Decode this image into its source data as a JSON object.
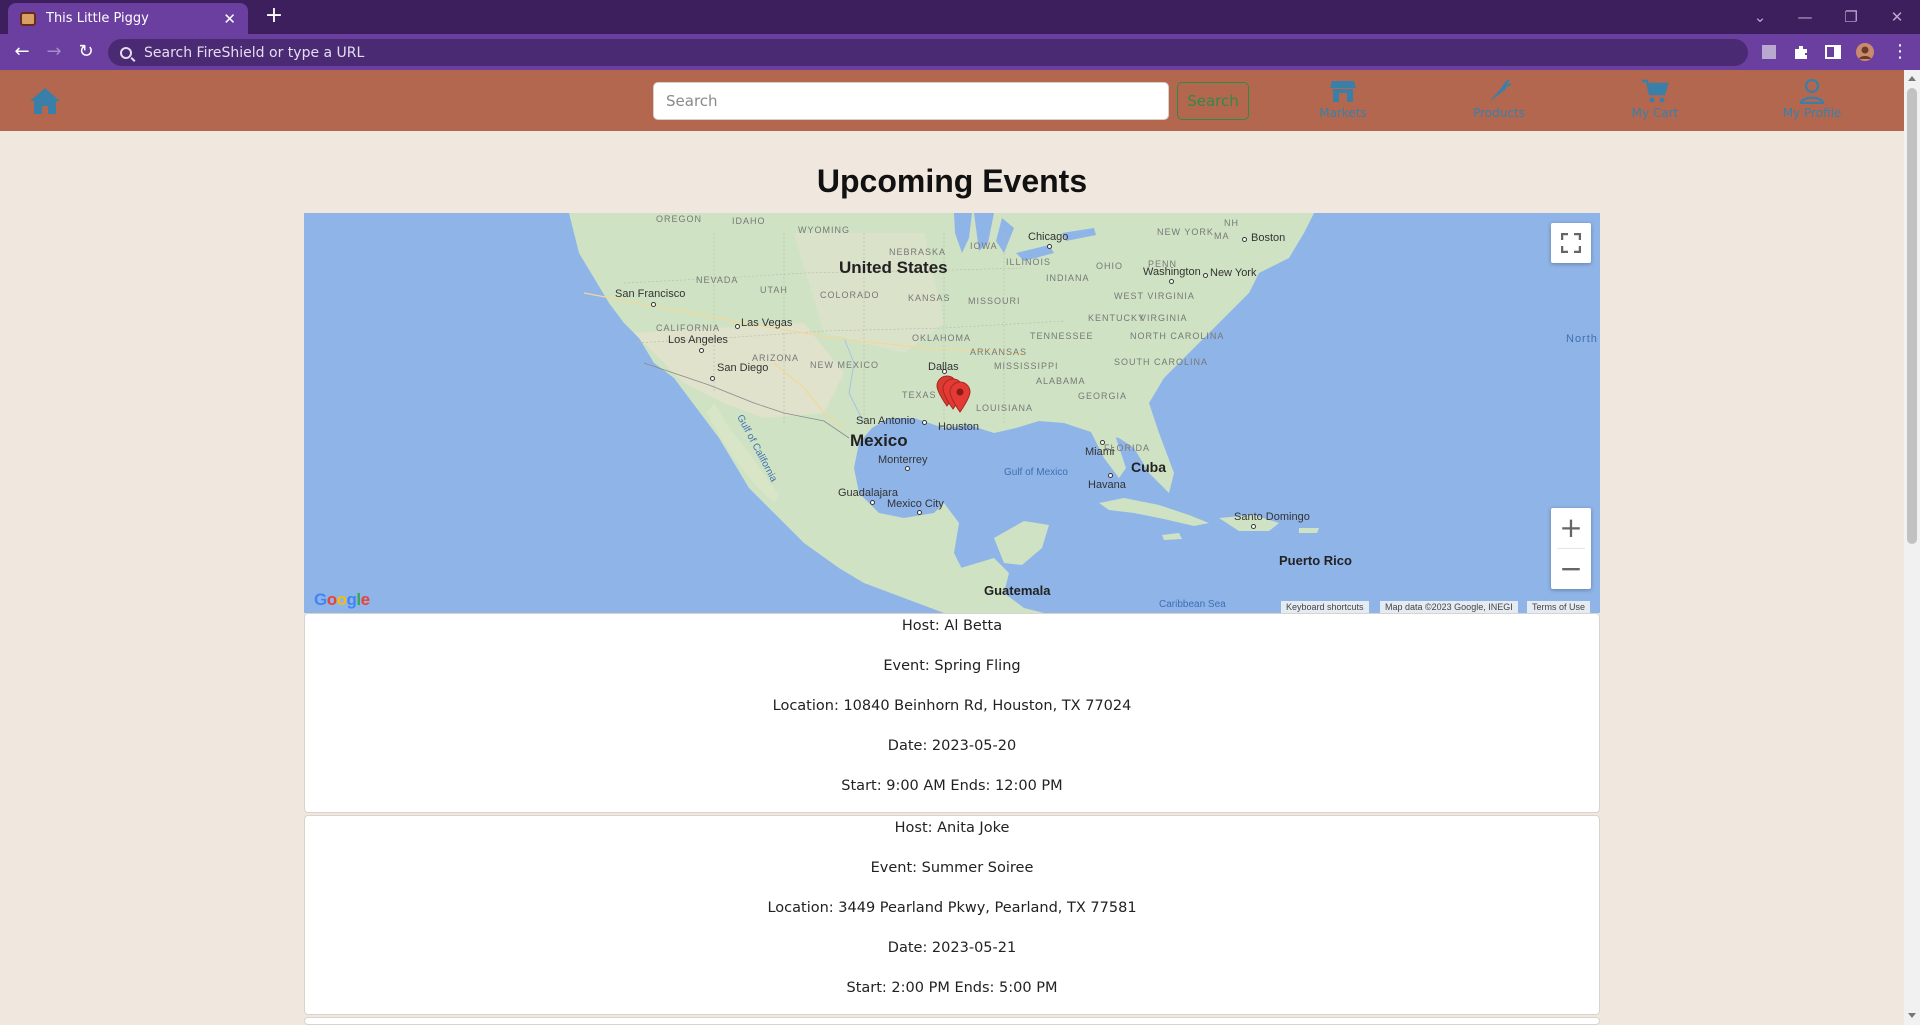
{
  "browser": {
    "tab_title": "This Little Piggy",
    "omnibox_placeholder": "Search FireShield or type a URL"
  },
  "header": {
    "search_placeholder": "Search",
    "search_button": "Search",
    "nav": [
      {
        "label": "Markets",
        "icon": "market-icon"
      },
      {
        "label": "Products",
        "icon": "carrot-icon"
      },
      {
        "label": "My Cart",
        "icon": "cart-icon"
      },
      {
        "label": "My Profile",
        "icon": "profile-icon"
      }
    ]
  },
  "page": {
    "title": "Upcoming Events"
  },
  "map": {
    "countries": [
      "United States",
      "Mexico",
      "Cuba",
      "Guatemala",
      "Puerto Rico"
    ],
    "states": [
      "OREGON",
      "IDAHO",
      "WYOMING",
      "NEBRASKA",
      "IOWA",
      "ILLINOIS",
      "NEVADA",
      "UTAH",
      "COLORADO",
      "KANSAS",
      "MISSOURI",
      "INDIANA",
      "OHIO",
      "PENN",
      "NEW YORK",
      "NH",
      "MA",
      "CALIFORNIA",
      "ARIZONA",
      "NEW MEXICO",
      "OKLAHOMA",
      "ARKANSAS",
      "TENNESSEE",
      "KENTUCKY",
      "WEST VIRGINIA",
      "VIRGINIA",
      "NORTH CAROLINA",
      "SOUTH CAROLINA",
      "MISSISSIPPI",
      "ALABAMA",
      "GEORGIA",
      "TEXAS",
      "LOUISIANA",
      "FLORIDA"
    ],
    "cities": [
      "San Francisco",
      "Las Vegas",
      "Los Angeles",
      "San Diego",
      "Dallas",
      "San Antonio",
      "Houston",
      "Chicago",
      "Boston",
      "New York",
      "Washington",
      "Monterrey",
      "Guadalajara",
      "Mexico City",
      "Miami",
      "Havana",
      "Santo Domingo"
    ],
    "waters": [
      "Gulf of Mexico",
      "Gulf of California",
      "Caribbean Sea",
      "North Atlantic Ocean"
    ],
    "attribution": {
      "keyboard": "Keyboard shortcuts",
      "data": "Map data ©2023 Google, INEGI",
      "terms": "Terms of Use"
    },
    "logo": "Google"
  },
  "events": [
    {
      "host": "Host: Al Betta",
      "event": "Event: Spring Fling",
      "location": "Location: 10840 Beinhorn Rd, Houston, TX 77024",
      "date": "Date: 2023-05-20",
      "time": "Start: 9:00 AM Ends: 12:00 PM"
    },
    {
      "host": "Host: Anita Joke",
      "event": "Event: Summer Soiree",
      "location": "Location: 3449 Pearland Pkwy, Pearland, TX 77581",
      "date": "Date: 2023-05-21",
      "time": "Start: 2:00 PM Ends: 5:00 PM"
    }
  ],
  "colors": {
    "header": "#b4674f",
    "page_bg": "#f0e8de",
    "tab_bar": "#3d1f5e",
    "toolbar": "#6b3fa0",
    "search_btn": "#2f8a48",
    "nav_icons": "#3a7fa8",
    "water": "#8fb4e8",
    "land": "#cfe3c4",
    "pin": "#e53935"
  }
}
